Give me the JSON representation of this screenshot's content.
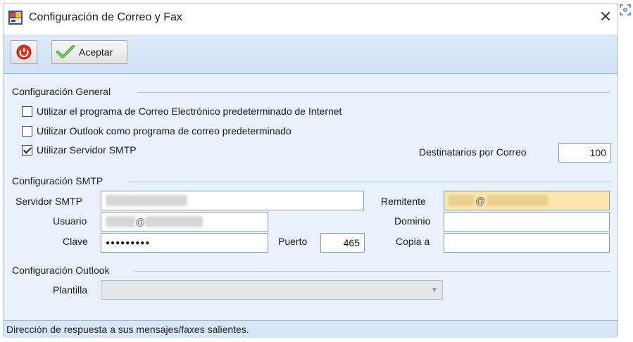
{
  "window": {
    "title": "Configuración de Correo y Fax"
  },
  "toolbar": {
    "accept_label": "Aceptar"
  },
  "general": {
    "title": "Configuración General",
    "option_default_client": "Utilizar el programa de Correo Electrónico predeterminado de Internet",
    "option_outlook": "Utilizar Outlook como programa de correo predeterminado",
    "option_smtp": "Utilizar Servidor SMTP",
    "option_smtp_checked": true,
    "recipients_label": "Destinatarios por Correo",
    "recipients_value": "100"
  },
  "smtp": {
    "title": "Configuración SMTP",
    "server_label": "Servidor SMTP",
    "user_label": "Usuario",
    "user_suffix": "@",
    "password_label": "Clave",
    "password_value": "●●●●●●●●●",
    "port_label": "Puerto",
    "port_value": "465",
    "sender_label": "Remitente",
    "sender_at": "@",
    "domain_label": "Dominio",
    "copy_label": "Copia a"
  },
  "outlook": {
    "title": "Configuración Outlook",
    "template_label": "Plantilla"
  },
  "status": {
    "text": "Dirección de respuesta a sus mensajes/faxes salientes."
  },
  "colors": {
    "accent": "#cfe1f7",
    "sender_field": "#fbe7ad"
  }
}
